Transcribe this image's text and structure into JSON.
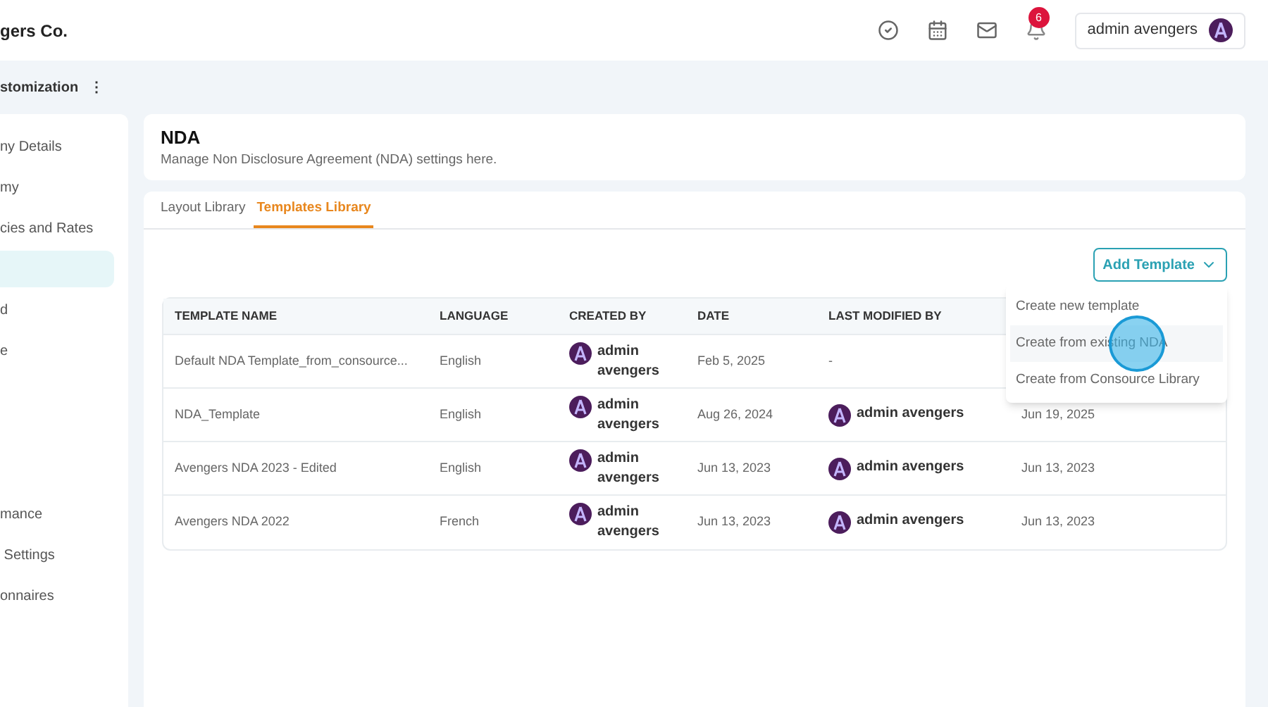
{
  "header": {
    "company": "gers Co.",
    "notification_count": "6",
    "user": "admin avengers"
  },
  "breadcrumb": {
    "title": "stomization",
    "menu": "⋮"
  },
  "sidebar": {
    "items": [
      {
        "label": "ny Details",
        "selected": false
      },
      {
        "label": "my",
        "selected": false
      },
      {
        "label": "cies and Rates",
        "selected": false
      },
      {
        "selected": true
      },
      {
        "label": "d",
        "selected": false
      },
      {
        "label": "e",
        "selected": false
      }
    ],
    "lower_items": [
      {
        "label": "mance",
        "selected": false
      },
      {
        "label": " Settings",
        "selected": false
      },
      {
        "label": "onnaires",
        "selected": false
      }
    ]
  },
  "page": {
    "title": "NDA",
    "subtitle": "Manage Non Disclosure Agreement (NDA) settings here."
  },
  "tabs": [
    {
      "label": "Layout Library",
      "selected": false
    },
    {
      "label": "Templates Library",
      "selected": true
    }
  ],
  "add_button": {
    "label": "Add Template",
    "expanded": true
  },
  "dropdown": [
    {
      "label": "Create new template",
      "selected": false
    },
    {
      "label": "Create from existing NDA",
      "selected": true
    },
    {
      "label": "Create from Consource Library",
      "selected": false
    }
  ],
  "table": {
    "columns": [
      "TEMPLATE NAME",
      "LANGUAGE",
      "CREATED BY",
      "DATE",
      "LAST MODIFIED BY"
    ],
    "rows": [
      {
        "name": "Default NDA Template_from_consource...",
        "language": "English",
        "created_by": "admin avengers",
        "date": "Feb 5, 2025",
        "modified_by": "-"
      },
      {
        "name": "NDA_Template",
        "language": "English",
        "created_by": "admin avengers",
        "date": "Aug 26, 2024",
        "modified_by": "admin avengers",
        "column_6": "Jun 19, 2025"
      },
      {
        "name": "Avengers NDA 2023 - Edited",
        "language": "English",
        "created_by": "admin avengers",
        "date": "Jun 13, 2023",
        "modified_by": "admin avengers",
        "column_6": "Jun 13, 2023"
      },
      {
        "name": "Avengers NDA 2022",
        "language": "French",
        "created_by": "admin avengers",
        "date": "Jun 13, 2023",
        "modified_by": "admin avengers",
        "column_6": "Jun 13, 2023"
      }
    ]
  }
}
